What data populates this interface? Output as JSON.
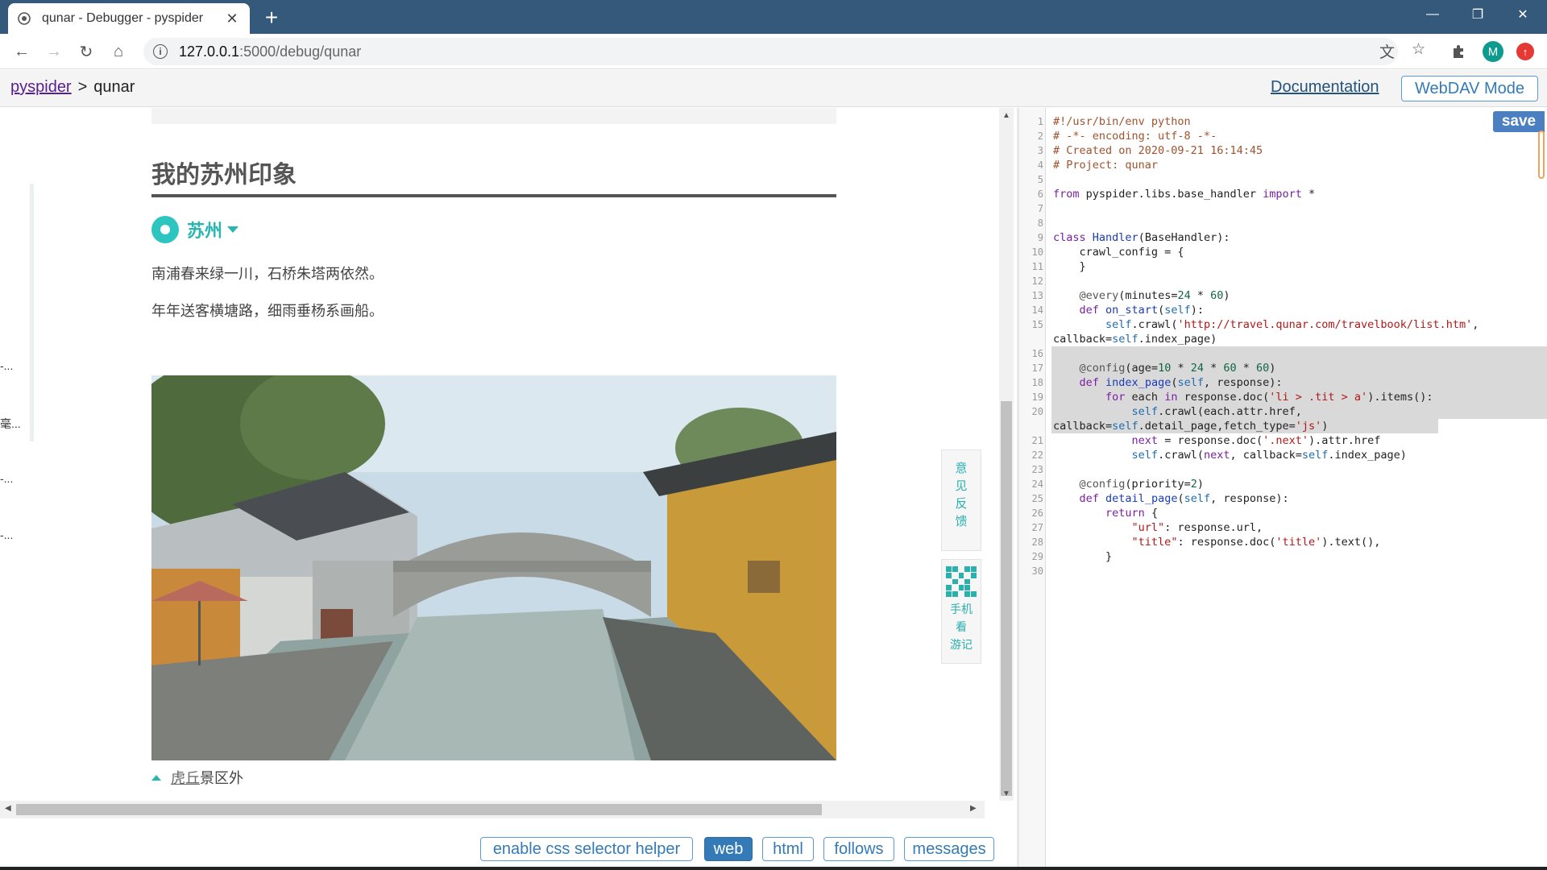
{
  "browser": {
    "tab_title": "qunar - Debugger - pyspider",
    "url_host": "127.0.0.1",
    "url_path": ":5000/debug/qunar",
    "avatar_letter": "M",
    "accent": "#35597a"
  },
  "header": {
    "breadcrumb_root": "pyspider",
    "breadcrumb_sep": ">",
    "breadcrumb_project": "qunar",
    "documentation": "Documentation",
    "webdav": "WebDAV Mode"
  },
  "preview": {
    "title": "我的苏州印象",
    "city": "苏州",
    "lines": [
      "南浦春来绿一川，石桥朱塔两依然。",
      "年年送客横塘路，细雨垂杨系画船。"
    ],
    "caption_link": "虎丘",
    "caption_rest": "景区外",
    "side_feedback": [
      "意",
      "见",
      "反",
      "馈"
    ],
    "side_mobile": [
      "手机",
      "看",
      "游记"
    ],
    "truncated": [
      "-...",
      "毫...",
      "-...",
      "-..."
    ]
  },
  "buttons": {
    "css_helper": "enable css selector helper",
    "web": "web",
    "html": "html",
    "follows": "follows",
    "messages": "messages"
  },
  "editor": {
    "save": "save",
    "code": [
      {
        "n": "1",
        "t": "#!/usr/bin/env python"
      },
      {
        "n": "2",
        "t": "# -*- encoding: utf-8 -*-"
      },
      {
        "n": "3",
        "t": "# Created on 2020-09-21 16:14:45"
      },
      {
        "n": "4",
        "t": "# Project: qunar"
      },
      {
        "n": "5",
        "t": ""
      },
      {
        "n": "6",
        "t": "from pyspider.libs.base_handler import *"
      },
      {
        "n": "7",
        "t": ""
      },
      {
        "n": "8",
        "t": ""
      },
      {
        "n": "9",
        "t": "class Handler(BaseHandler):"
      },
      {
        "n": "10",
        "t": "    crawl_config = {"
      },
      {
        "n": "11",
        "t": "    }"
      },
      {
        "n": "12",
        "t": ""
      },
      {
        "n": "13",
        "t": "    @every(minutes=24 * 60)"
      },
      {
        "n": "14",
        "t": "    def on_start(self):"
      },
      {
        "n": "15",
        "t": "        self.crawl('http://travel.qunar.com/travelbook/list.htm',"
      },
      {
        "n": "",
        "t": "callback=self.index_page)"
      },
      {
        "n": "16",
        "t": ""
      },
      {
        "n": "17",
        "t": "    @config(age=10 * 24 * 60 * 60)"
      },
      {
        "n": "18",
        "t": "    def index_page(self, response):"
      },
      {
        "n": "19",
        "t": "        for each in response.doc('li > .tit > a').items():"
      },
      {
        "n": "20",
        "t": "            self.crawl(each.attr.href,"
      },
      {
        "n": "",
        "t": "callback=self.detail_page,fetch_type='js')"
      },
      {
        "n": "21",
        "t": "            next = response.doc('.next').attr.href"
      },
      {
        "n": "22",
        "t": "            self.crawl(next, callback=self.index_page)"
      },
      {
        "n": "23",
        "t": ""
      },
      {
        "n": "24",
        "t": "    @config(priority=2)"
      },
      {
        "n": "25",
        "t": "    def detail_page(self, response):"
      },
      {
        "n": "26",
        "t": "        return {"
      },
      {
        "n": "27",
        "t": "            \"url\": response.url,"
      },
      {
        "n": "28",
        "t": "            \"title\": response.doc('title').text(),"
      },
      {
        "n": "29",
        "t": "        }"
      },
      {
        "n": "30",
        "t": ""
      }
    ]
  }
}
